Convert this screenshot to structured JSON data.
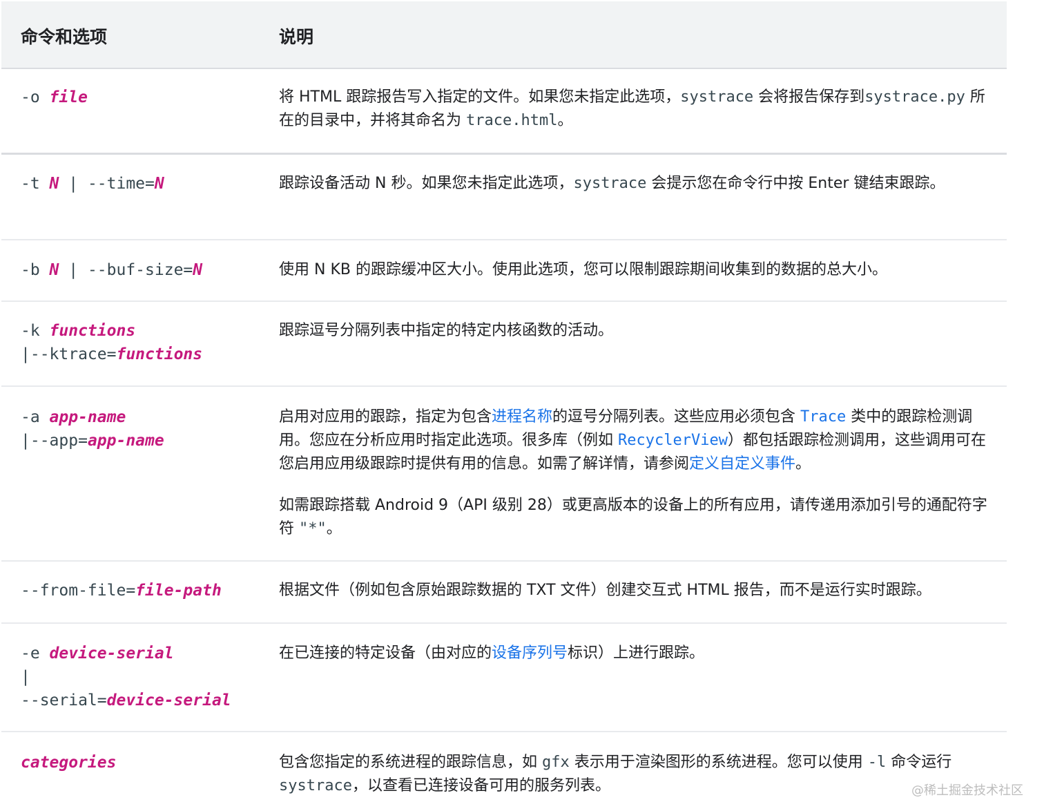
{
  "header": {
    "col1": "命令和选项",
    "col2": "说明"
  },
  "rows": {
    "r1": {
      "cmd_a": "-o ",
      "var_a": "file",
      "d1": "将 HTML 跟踪报告写入指定的文件。如果您未指定此选项，",
      "c1": "systrace",
      "d2": " 会将报告保存到",
      "c2": "systrace.py",
      "d3": " 所在的目录中，并将其命名为 ",
      "c3": "trace.html",
      "d4": "。"
    },
    "r2": {
      "cmd_a": "-t ",
      "var_a": "N",
      "cmd_b": " | --time=",
      "var_b": "N",
      "d1": "跟踪设备活动 N 秒。如果您未指定此选项，",
      "c1": "systrace",
      "d2": " 会提示您在命令行中按 Enter 键结束跟踪。"
    },
    "r3": {
      "cmd_a": "-b ",
      "var_a": "N",
      "cmd_b": " | --buf-size=",
      "var_b": "N",
      "d1": "使用 N KB 的跟踪缓冲区大小。使用此选项，您可以限制跟踪期间收集到的数据的总大小。"
    },
    "r4": {
      "cmd_a": "-k ",
      "var_a": "functions",
      "cmd_b": "|--ktrace=",
      "var_b": "functions",
      "d1": "跟踪逗号分隔列表中指定的特定内核函数的活动。"
    },
    "r5": {
      "cmd_a": "-a ",
      "var_a": "app-name",
      "cmd_b": "|--app=",
      "var_b": "app-name",
      "d1": "启用对应用的跟踪，指定为包含",
      "l1": "进程名称",
      "d2": "的逗号分隔列表。这些应用必须包含 ",
      "cl1": "Trace",
      "d3": " 类中的跟踪检测调用。您应在分析应用时指定此选项。很多库（例如 ",
      "cl2": "RecyclerView",
      "d4": "）都包括跟踪检测调用，这些调用可在您启用应用级跟踪时提供有用的信息。如需了解详情，请参阅",
      "l2": "定义自定义事件",
      "d5": "。",
      "p2a": "如需跟踪搭载 Android 9（API 级别 28）或更高版本的设备上的所有应用，请传递用添加引号的通配符字符 ",
      "p2c": "\"*\"",
      "p2b": "。"
    },
    "r6": {
      "cmd_a": "--from-file=",
      "var_a": "file-path",
      "d1": "根据文件（例如包含原始跟踪数据的 TXT 文件）创建交互式 HTML 报告，而不是运行实时跟踪。"
    },
    "r7": {
      "cmd_a": "-e ",
      "var_a": "device-serial",
      "cmd_b": "|",
      "cmd_c": "--serial=",
      "var_c": "device-serial",
      "d1": "在已连接的特定设备（由对应的",
      "l1": "设备序列号",
      "d2": "标识）上进行跟踪。"
    },
    "r8": {
      "var_a": "categories",
      "d1": "包含您指定的系统进程的跟踪信息，如 ",
      "c1": "gfx",
      "d2": " 表示用于渲染图形的系统进程。您可以使用 ",
      "c2": "-l",
      "d3": " 命令运行 ",
      "c3": "systrace",
      "d4": "，以查看已连接设备可用的服务列表。"
    }
  },
  "watermark": "@稀土掘金技术社区"
}
